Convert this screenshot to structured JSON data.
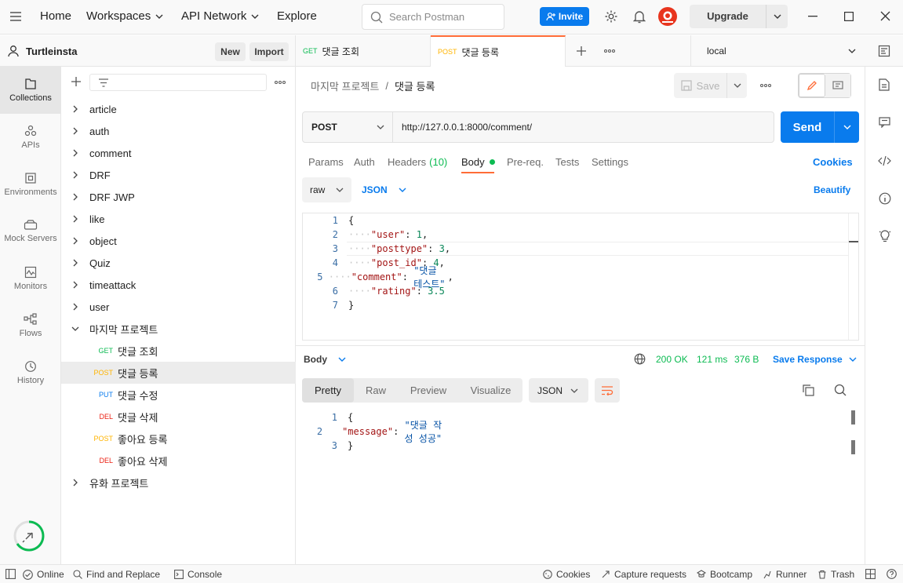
{
  "topbar": {
    "home": "Home",
    "workspaces": "Workspaces",
    "api_network": "API Network",
    "explore": "Explore",
    "search_placeholder": "Search Postman",
    "invite": "Invite",
    "upgrade": "Upgrade"
  },
  "workspace": {
    "name": "Turtleinsta",
    "new": "New",
    "import": "Import"
  },
  "rail": [
    {
      "label": "Collections",
      "icon": "collections-icon"
    },
    {
      "label": "APIs",
      "icon": "apis-icon"
    },
    {
      "label": "Environments",
      "icon": "environments-icon"
    },
    {
      "label": "Mock Servers",
      "icon": "mock-servers-icon"
    },
    {
      "label": "Monitors",
      "icon": "monitors-icon"
    },
    {
      "label": "Flows",
      "icon": "flows-icon"
    },
    {
      "label": "History",
      "icon": "history-icon"
    }
  ],
  "collections": [
    {
      "label": "article"
    },
    {
      "label": "auth"
    },
    {
      "label": "comment"
    },
    {
      "label": "DRF"
    },
    {
      "label": "DRF JWP"
    },
    {
      "label": "like"
    },
    {
      "label": "object"
    },
    {
      "label": "Quiz"
    },
    {
      "label": "timeattack"
    },
    {
      "label": "user"
    },
    {
      "label": "마지막 프로젝트"
    }
  ],
  "requests": [
    {
      "method": "GET",
      "label": "댓글 조회",
      "color": "#0cbb52"
    },
    {
      "method": "POST",
      "label": "댓글 등록",
      "color": "#ffb400"
    },
    {
      "method": "PUT",
      "label": "댓글 수정",
      "color": "#097bed"
    },
    {
      "method": "DEL",
      "label": "댓글 삭제",
      "color": "#eb2013"
    },
    {
      "method": "POST",
      "label": "좋아요 등록",
      "color": "#ffb400"
    },
    {
      "method": "DEL",
      "label": "좋아요 삭제",
      "color": "#eb2013"
    }
  ],
  "last_collection": "유화 프로젝트",
  "tabs": [
    {
      "method": "GET",
      "label": "댓글 조회",
      "color": "#0cbb52"
    },
    {
      "method": "POST",
      "label": "댓글 등록",
      "color": "#ffb400"
    }
  ],
  "environment": "local",
  "breadcrumb": {
    "parent": "마지막 프로젝트",
    "sep": "/",
    "current": "댓글 등록"
  },
  "save": "Save",
  "request": {
    "method": "POST",
    "url": "http://127.0.0.1:8000/comment/",
    "send": "Send"
  },
  "req_tabs": {
    "params": "Params",
    "auth": "Auth",
    "headers": "Headers",
    "headers_count": "(10)",
    "body": "Body",
    "prereq": "Pre-req.",
    "tests": "Tests",
    "settings": "Settings",
    "cookies": "Cookies"
  },
  "body_opts": {
    "raw": "raw",
    "json": "JSON",
    "beautify": "Beautify"
  },
  "request_body": [
    {
      "n": "1",
      "text": "{"
    },
    {
      "n": "2",
      "key": "\"user\"",
      "val": "1",
      "type": "num",
      "comma": ","
    },
    {
      "n": "3",
      "key": "\"posttype\"",
      "val": "3",
      "type": "num",
      "comma": ","
    },
    {
      "n": "4",
      "key": "\"post_id\"",
      "val": "4",
      "type": "num",
      "comma": ","
    },
    {
      "n": "5",
      "key": "\"comment\"",
      "val": "\"댓글 테스트\"",
      "type": "str",
      "comma": ","
    },
    {
      "n": "6",
      "key": "\"rating\"",
      "val": "3.5",
      "type": "num",
      "comma": ""
    },
    {
      "n": "7",
      "text": "}"
    }
  ],
  "response": {
    "label": "Body",
    "status": "200 OK",
    "time": "121 ms",
    "size": "376 B",
    "save_response": "Save Response",
    "views": [
      "Pretty",
      "Raw",
      "Preview",
      "Visualize"
    ],
    "format": "JSON",
    "lines": [
      {
        "n": "1",
        "text": "{"
      },
      {
        "n": "2",
        "key": "\"message\"",
        "val": "\"댓글 작성 성공\""
      },
      {
        "n": "3",
        "text": "}"
      }
    ]
  },
  "statusbar": {
    "online": "Online",
    "find_replace": "Find and Replace",
    "console": "Console",
    "cookies": "Cookies",
    "capture": "Capture requests",
    "bootcamp": "Bootcamp",
    "runner": "Runner",
    "trash": "Trash"
  }
}
